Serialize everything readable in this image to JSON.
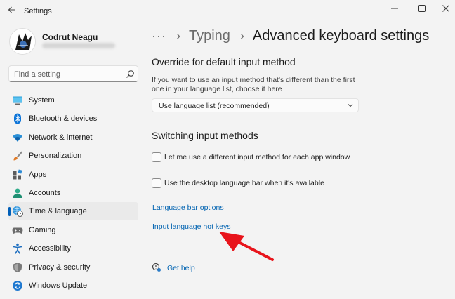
{
  "window": {
    "app_title": "Settings",
    "controls": {
      "minimize": "–",
      "maximize": "☐",
      "close": "✕"
    }
  },
  "profile": {
    "name": "Codrut Neagu"
  },
  "search": {
    "placeholder": "Find a setting"
  },
  "sidebar": {
    "items": [
      {
        "label": "System",
        "icon": "system-icon",
        "active": false
      },
      {
        "label": "Bluetooth & devices",
        "icon": "bluetooth-icon",
        "active": false
      },
      {
        "label": "Network & internet",
        "icon": "wifi-icon",
        "active": false
      },
      {
        "label": "Personalization",
        "icon": "brush-icon",
        "active": false
      },
      {
        "label": "Apps",
        "icon": "apps-icon",
        "active": false
      },
      {
        "label": "Accounts",
        "icon": "accounts-icon",
        "active": false
      },
      {
        "label": "Time & language",
        "icon": "globe-clock-icon",
        "active": true
      },
      {
        "label": "Gaming",
        "icon": "gamepad-icon",
        "active": false
      },
      {
        "label": "Accessibility",
        "icon": "accessibility-icon",
        "active": false
      },
      {
        "label": "Privacy & security",
        "icon": "shield-icon",
        "active": false
      },
      {
        "label": "Windows Update",
        "icon": "update-icon",
        "active": false
      }
    ]
  },
  "breadcrumb": {
    "more": "···",
    "separator": "›",
    "parent": "Typing",
    "current": "Advanced keyboard settings"
  },
  "override": {
    "title": "Override for default input method",
    "description": "If you want to use an input method that's different than the first one in your language list, choose it here",
    "dropdown_value": "Use language list (recommended)"
  },
  "switching": {
    "title": "Switching input methods",
    "checkbox_per_app": "Let me use a different input method for each app window",
    "checkbox_per_app_checked": false,
    "checkbox_language_bar": "Use the desktop language bar when it's available",
    "checkbox_language_bar_checked": false
  },
  "links": {
    "language_bar_options": "Language bar options",
    "input_language_hot_keys": "Input language hot keys"
  },
  "help": {
    "label": "Get help"
  },
  "colors": {
    "accent": "#005fb8",
    "link": "#0063b1",
    "annotation_arrow": "#e8141b"
  }
}
